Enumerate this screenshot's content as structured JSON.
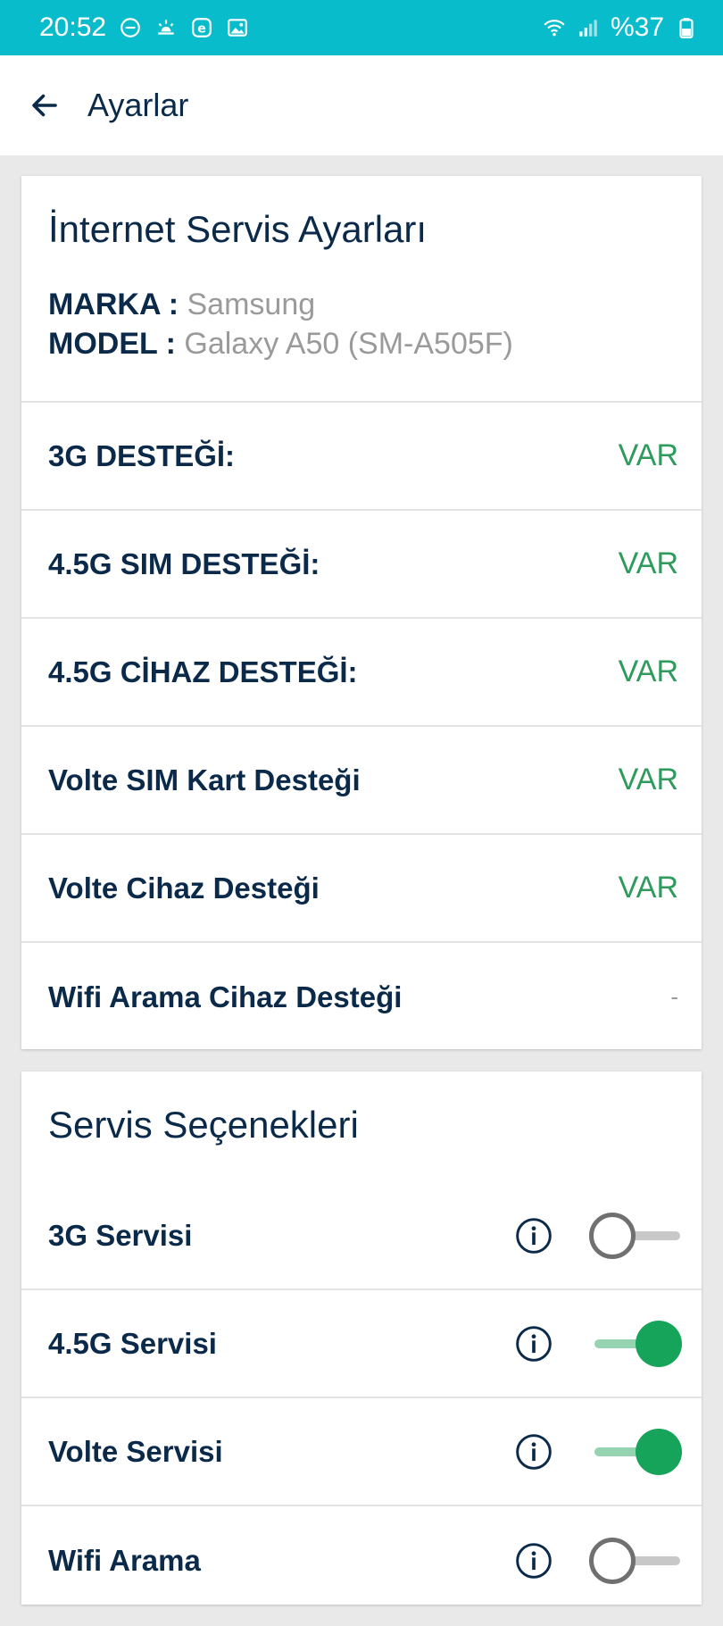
{
  "status_bar": {
    "time": "20:52",
    "battery": "%37",
    "left_icons": [
      "minus-circle-icon",
      "weather-icon",
      "e-badge-icon",
      "image-icon"
    ],
    "right_icons": [
      "wifi-icon",
      "signal-icon",
      "battery-icon"
    ]
  },
  "app_bar": {
    "title": "Ayarlar"
  },
  "internet_settings": {
    "title": "İnternet Servis Ayarları",
    "brand_label": "MARKA :",
    "brand_value": "Samsung",
    "model_label": "MODEL :",
    "model_value": "Galaxy A50 (SM-A505F)",
    "rows": [
      {
        "label": "3G DESTEĞİ:",
        "value": "VAR"
      },
      {
        "label": "4.5G SIM DESTEĞİ:",
        "value": "VAR"
      },
      {
        "label": "4.5G CİHAZ DESTEĞİ:",
        "value": "VAR"
      },
      {
        "label": "Volte SIM Kart Desteği",
        "value": "VAR"
      },
      {
        "label": "Volte Cihaz Desteği",
        "value": "VAR"
      },
      {
        "label": "Wifi Arama Cihaz Desteği",
        "value": "-"
      }
    ]
  },
  "service_options": {
    "title": "Servis Seçenekleri",
    "rows": [
      {
        "label": "3G Servisi",
        "enabled": false
      },
      {
        "label": "4.5G Servisi",
        "enabled": true
      },
      {
        "label": "Volte Servisi",
        "enabled": true
      },
      {
        "label": "Wifi Arama",
        "enabled": false
      }
    ]
  },
  "colors": {
    "status_bar": "#09bccb",
    "primary_text": "#0b2a4a",
    "value_green": "#2e9a5c",
    "toggle_on": "#16a35a"
  }
}
